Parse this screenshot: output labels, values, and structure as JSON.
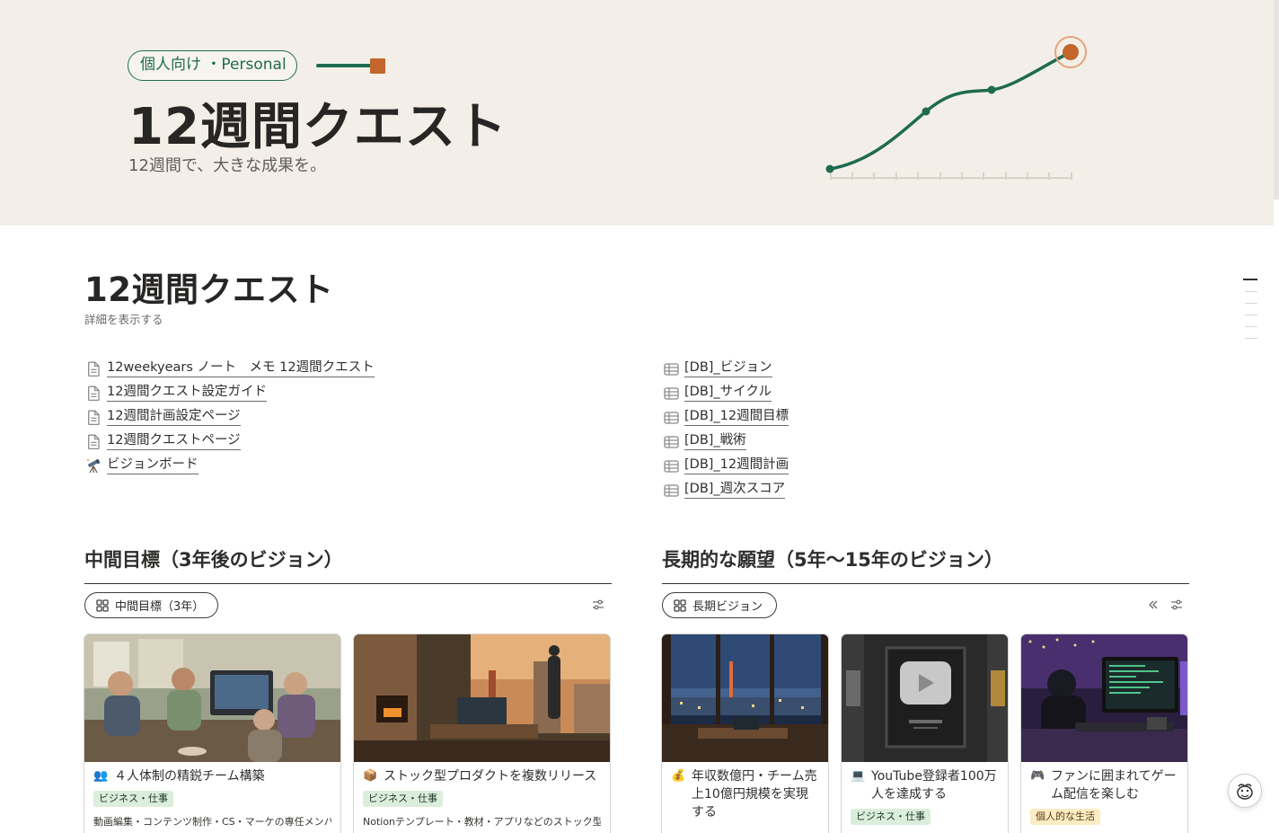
{
  "cover": {
    "pill_label": "個人向け ・Personal",
    "title": "12週間クエスト",
    "subtitle": "12週間で、大きな成果を。",
    "colors": {
      "background": "#f3efe8",
      "accent_green": "#1f6b4f",
      "accent_orange": "#c2662c"
    }
  },
  "page": {
    "title": "12週間クエスト",
    "show_details": "詳細を表示する"
  },
  "links_left": [
    {
      "icon": "page-icon",
      "label": "12weekyears ノート　メモ 12週間クエスト"
    },
    {
      "icon": "page-icon",
      "label": "12週間クエスト設定ガイド"
    },
    {
      "icon": "page-icon",
      "label": "12週間計画設定ページ"
    },
    {
      "icon": "page-icon",
      "label": "12週間クエストページ"
    },
    {
      "icon": "telescope-icon",
      "label": "ビジョンボード"
    }
  ],
  "links_right": [
    {
      "icon": "table-icon",
      "label": "[DB]_ビジョン"
    },
    {
      "icon": "table-icon",
      "label": "[DB]_サイクル"
    },
    {
      "icon": "table-icon",
      "label": "[DB]_12週間目標"
    },
    {
      "icon": "table-icon",
      "label": "[DB]_戦術"
    },
    {
      "icon": "table-icon",
      "label": "[DB]_12週間計画"
    },
    {
      "icon": "table-icon",
      "label": "[DB]_週次スコア"
    }
  ],
  "sections": {
    "mid": {
      "title": "中間目標（3年後のビジョン）",
      "view_label": "中間目標（3年）",
      "cards": [
        {
          "emoji": "👥",
          "title": "４人体制の精鋭チーム構築",
          "tag": "ビジネス・仕事",
          "tag_type": "biz",
          "desc": "動画編集・コンテンツ制作・CS・マーケの専任メンバ"
        },
        {
          "emoji": "📦",
          "title": "ストック型プロダクトを複数リリース",
          "tag": "ビジネス・仕事",
          "tag_type": "biz",
          "desc": "Notionテンプレート・教材・アプリなどのストック型"
        }
      ]
    },
    "long": {
      "title": "長期的な願望（5年〜15年のビジョン）",
      "view_label": "長期ビジョン",
      "cards": [
        {
          "emoji": "💰",
          "title": "年収数億円・チーム売上10億円規模を実現する",
          "tag": "",
          "tag_type": "biz",
          "desc": ""
        },
        {
          "emoji": "💻",
          "title": "YouTube登録者100万人を達成する",
          "tag": "ビジネス・仕事",
          "tag_type": "biz",
          "desc": ""
        },
        {
          "emoji": "🎮",
          "title": "ファンに囲まれてゲーム配信を楽しむ",
          "tag": "個人的な生活",
          "tag_type": "life",
          "desc": ""
        }
      ]
    }
  }
}
